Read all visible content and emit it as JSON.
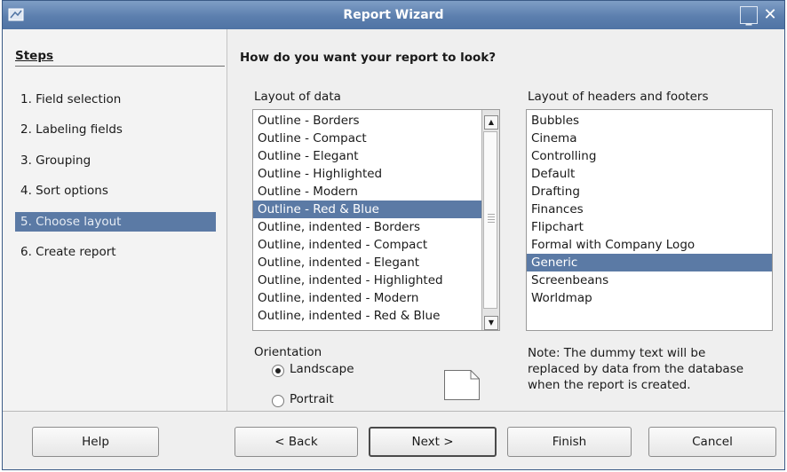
{
  "window": {
    "title": "Report Wizard"
  },
  "steps": {
    "title": "Steps",
    "items": [
      {
        "label": "1. Field selection"
      },
      {
        "label": "2. Labeling fields"
      },
      {
        "label": "3. Grouping"
      },
      {
        "label": "4. Sort options"
      },
      {
        "label": "5. Choose layout",
        "active": true
      },
      {
        "label": "6. Create report"
      }
    ]
  },
  "main": {
    "heading": "How do you want your report to look?",
    "layout_of_data": {
      "label": "Layout of data",
      "selected": "Outline - Red & Blue",
      "items": [
        "Outline - Borders",
        "Outline - Compact",
        "Outline - Elegant",
        "Outline - Highlighted",
        "Outline - Modern",
        "Outline - Red & Blue",
        "Outline, indented - Borders",
        "Outline, indented - Compact",
        "Outline, indented - Elegant",
        "Outline, indented - Highlighted",
        "Outline, indented - Modern",
        "Outline, indented - Red & Blue"
      ]
    },
    "layout_headers_footers": {
      "label": "Layout of headers and footers",
      "selected": "Generic",
      "items": [
        "Bubbles",
        "Cinema",
        "Controlling",
        "Default",
        "Drafting",
        "Finances",
        "Flipchart",
        "Formal with Company Logo",
        "Generic",
        "Screenbeans",
        "Worldmap"
      ]
    },
    "orientation": {
      "label": "Orientation",
      "landscape": "Landscape",
      "portrait": "Portrait",
      "selected": "Landscape"
    },
    "note": "Note: The dummy text will be replaced by data from the database when the report is created."
  },
  "buttons": {
    "help": "Help",
    "back": "< Back",
    "next": "Next >",
    "finish": "Finish",
    "cancel": "Cancel"
  },
  "colors": {
    "titlebar": "#5c7fae",
    "selection": "#5b7aa5"
  }
}
